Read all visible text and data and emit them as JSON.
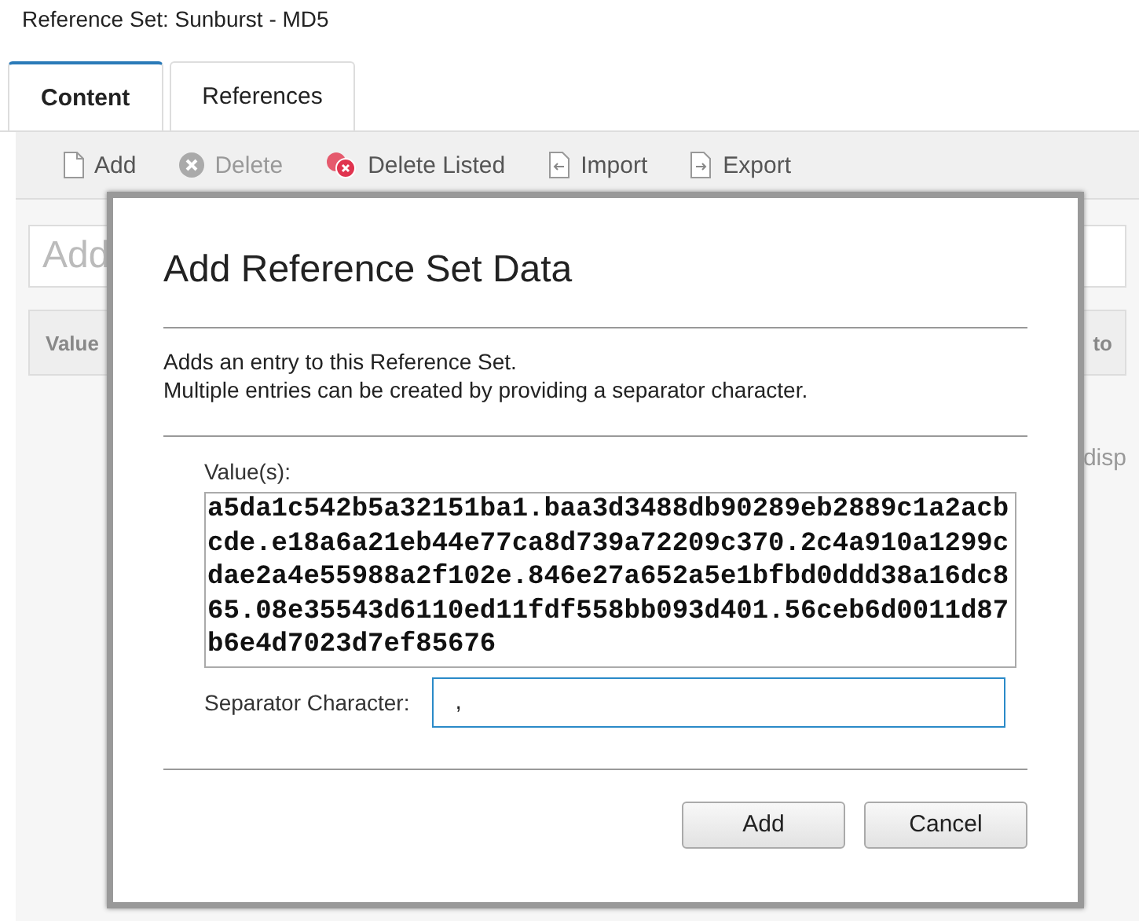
{
  "page_title": "Reference Set: Sunburst - MD5",
  "tabs": [
    {
      "label": "Content",
      "selected": true
    },
    {
      "label": "References",
      "selected": false
    }
  ],
  "toolbar": [
    {
      "label": "Add",
      "kind": "add",
      "disabled": false
    },
    {
      "label": "Delete",
      "kind": "delete",
      "disabled": true
    },
    {
      "label": "Delete Listed",
      "kind": "delete-listed",
      "disabled": false
    },
    {
      "label": "Import",
      "kind": "import",
      "disabled": false
    },
    {
      "label": "Export",
      "kind": "export",
      "disabled": false
    }
  ],
  "filter_field": {
    "placeholder": "Add"
  },
  "table": {
    "columns": [
      "Value",
      "to"
    ],
    "empty_message": "disp"
  },
  "dialog": {
    "title": "Add Reference Set Data",
    "description": [
      "Adds an entry to this Reference Set.",
      "Multiple entries can be created by providing a separator character."
    ],
    "values_label": "Value(s):",
    "values": "a5da1c542b5a32151ba1.baa3d3488db90289eb2889c1a2acbcde.e18a6a21eb44e77ca8d739a72209c370.2c4a910a1299cdae2a4e55988a2f102e.846e27a652a5e1bfbd0ddd38a16dc865.08e35543d6110ed11fdf558bb093d401.56ceb6d0011d87b6e4d7023d7ef85676",
    "separator_label": "Separator Character:",
    "separator": ",",
    "buttons": [
      "Add",
      "Cancel"
    ]
  }
}
